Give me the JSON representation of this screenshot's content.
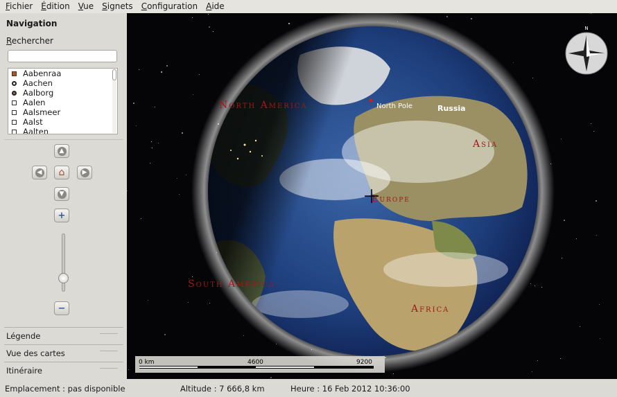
{
  "menu": [
    "Fichier",
    "Édition",
    "Vue",
    "Signets",
    "Configuration",
    "Aide"
  ],
  "sidebar": {
    "title": "Navigation",
    "search_label": "Rechercher",
    "search_value": "",
    "cities": [
      {
        "name": "Aabenraa",
        "marker": "square-brown"
      },
      {
        "name": "Aachen",
        "marker": "ring"
      },
      {
        "name": "Aalborg",
        "marker": "ring-brown"
      },
      {
        "name": "Aalen",
        "marker": "square"
      },
      {
        "name": "Aalsmeer",
        "marker": "square"
      },
      {
        "name": "Aalst",
        "marker": "square"
      },
      {
        "name": "Aalten",
        "marker": "square"
      }
    ],
    "nav_buttons": {
      "up": "▲",
      "left": "◀",
      "home": "⌂",
      "right": "▶",
      "down": "▼",
      "zoom_in": "+",
      "zoom_out": "−"
    },
    "zoom_level": 0.18,
    "panels": [
      "Légende",
      "Vue des cartes",
      "Itinéraire"
    ]
  },
  "map": {
    "labels": {
      "north_america": "North America",
      "north_pole": "North Pole",
      "russia": "Russia",
      "asia": "Asia",
      "europe": "Europe",
      "south_america": "South America",
      "africa": "Africa"
    },
    "compass_label": "N",
    "scale": {
      "start": "0 km",
      "mid": "4600",
      "end": "9200"
    }
  },
  "status": {
    "location": "Emplacement : pas disponible",
    "altitude": "Altitude :  7 666,8 km",
    "time": "Heure : 16 Feb 2012 10:36:00"
  },
  "colors": {
    "label_red": "#a01818",
    "ocean": "#1c3c78",
    "land": "#8a8050",
    "space": "#050507"
  }
}
